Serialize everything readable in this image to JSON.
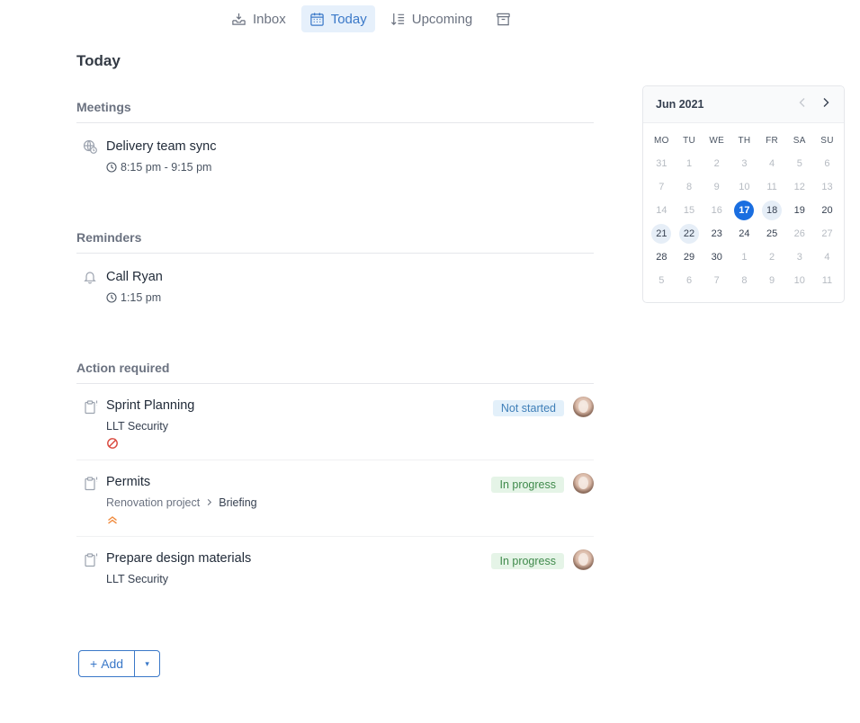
{
  "nav": {
    "tabs": [
      {
        "label": "Inbox",
        "icon": "inbox-icon"
      },
      {
        "label": "Today",
        "icon": "calendar-icon"
      },
      {
        "label": "Upcoming",
        "icon": "sort-icon"
      },
      {
        "label": "",
        "icon": "archive-icon"
      }
    ],
    "active": "Today"
  },
  "page": {
    "title": "Today"
  },
  "meetings": {
    "heading": "Meetings",
    "items": [
      {
        "title": "Delivery team sync",
        "time": "8:15 pm - 9:15 pm",
        "icon": "globe-clock-icon"
      }
    ]
  },
  "reminders": {
    "heading": "Reminders",
    "items": [
      {
        "title": "Call Ryan",
        "time": "1:15 pm",
        "icon": "bell-icon"
      }
    ]
  },
  "actions": {
    "heading": "Action required",
    "items": [
      {
        "title": "Sprint Planning",
        "project": "LLT Security",
        "status": "Not started",
        "priority_icon": "blocked-icon"
      },
      {
        "title": "Permits",
        "project": "Renovation project",
        "sub": "Briefing",
        "status": "In progress",
        "priority_icon": "double-chevron-up-icon"
      },
      {
        "title": "Prepare design materials",
        "project": "LLT Security",
        "status": "In progress"
      }
    ]
  },
  "add_button": {
    "label": "Add",
    "plus": "+",
    "caret": "▾"
  },
  "calendar": {
    "title": "Jun 2021",
    "prev": "‹",
    "next": "›",
    "weekdays": [
      "MO",
      "TU",
      "WE",
      "TH",
      "FR",
      "SA",
      "SU"
    ],
    "selected_day": "17",
    "weeks": [
      [
        "31",
        "1",
        "2",
        "3",
        "4",
        "5",
        "6"
      ],
      [
        "7",
        "8",
        "9",
        "10",
        "11",
        "12",
        "13"
      ],
      [
        "14",
        "15",
        "16",
        "17",
        "18",
        "19",
        "20"
      ],
      [
        "21",
        "22",
        "23",
        "24",
        "25",
        "26",
        "27"
      ],
      [
        "28",
        "29",
        "30",
        "1",
        "2",
        "3",
        "4"
      ],
      [
        "5",
        "6",
        "7",
        "8",
        "9",
        "10",
        "11"
      ]
    ]
  },
  "colors": {
    "accent": "#1a6ee0",
    "link": "#3a78c8",
    "blocked": "#d9463b",
    "high_priority": "#f08a3c"
  }
}
